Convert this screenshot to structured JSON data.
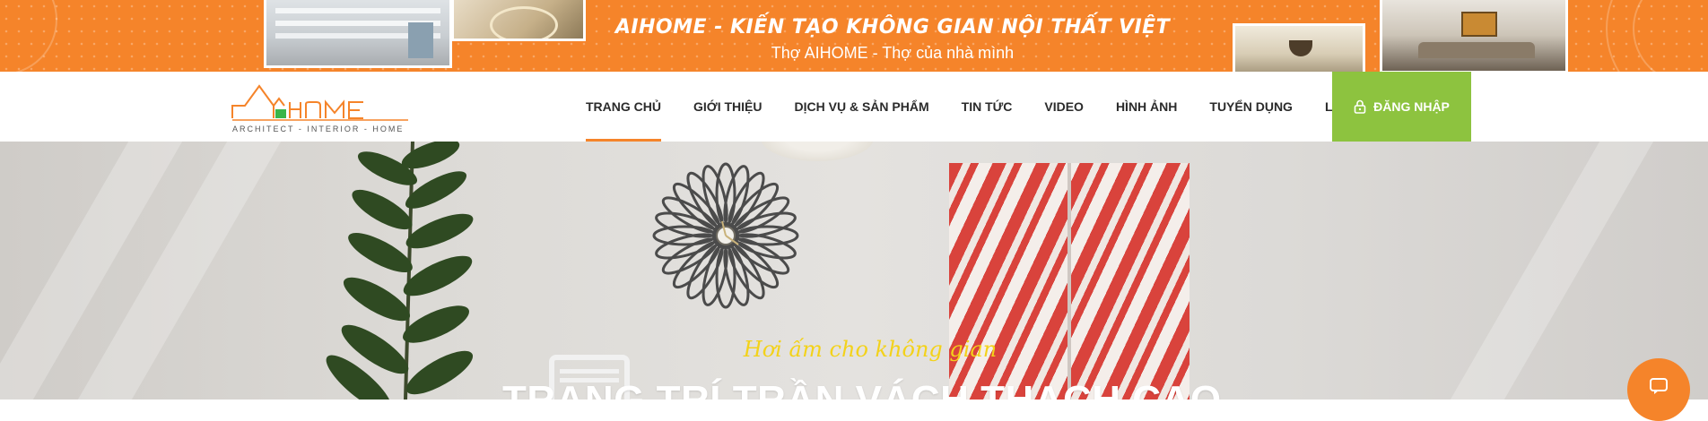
{
  "banner": {
    "title": "AIHOME - KIẾN TẠO KHÔNG GIAN NỘI THẤT VIỆT",
    "subtitle": "Thợ AIHOME - Thợ của nhà mình"
  },
  "nav": {
    "logo_tagline": "ARCHITECT - INTERIOR - HOME",
    "items": [
      {
        "label": "TRANG CHỦ",
        "active": true
      },
      {
        "label": "GIỚI THIỆU",
        "active": false
      },
      {
        "label": "DỊCH VỤ & SẢN PHẨM",
        "active": false
      },
      {
        "label": "TIN TỨC",
        "active": false
      },
      {
        "label": "VIDEO",
        "active": false
      },
      {
        "label": "HÌNH ẢNH",
        "active": false
      },
      {
        "label": "TUYỂN DỤNG",
        "active": false
      },
      {
        "label": "LIÊN HỆ",
        "active": false
      }
    ],
    "login_label": "ĐĂNG NHẬP",
    "login_icon": "lock-icon"
  },
  "hero": {
    "tagline": "Hơi ấm cho không gian",
    "heading": "TRANG TRÍ TRẦN VÁCH THẠCH CAO"
  },
  "colors": {
    "brand_orange": "#f5842a",
    "login_green": "#8dc33f",
    "tagline_yellow": "#f3d21a"
  }
}
